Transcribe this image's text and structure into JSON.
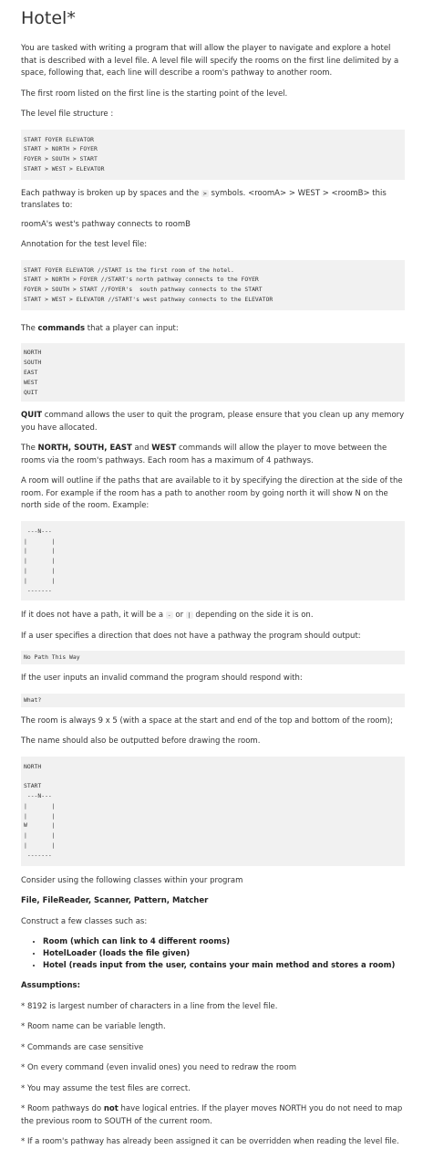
{
  "title": "Hotel*",
  "intro": "You are tasked with writing a program that will allow the player to navigate and explore a hotel that is described with a level file. A level file will specify the rooms on the first line delimited by a space, following that, each line will describe a room's pathway to another room.",
  "first_room": "The first room listed on the first line is the starting point of the level.",
  "structure_label": "The level file structure :",
  "structure_code": "START FOYER ELEVATOR\nSTART > NORTH > FOYER\nFOYER > SOUTH > START\nSTART > WEST > ELEVATOR",
  "pathway_pre": "Each pathway is broken up by spaces and the ",
  "pathway_symbol": ">",
  "pathway_post": " symbols. <roomA> > WEST  > <roomB> this translates to:",
  "pathway_result": "roomA's west's pathway connects to roomB",
  "annotation_label": "Annotation for the test level file:",
  "annotation_code": "START FOYER ELEVATOR //START is the first room of the hotel.\nSTART > NORTH > FOYER //START's north pathway connects to the FOYER\nFOYER > SOUTH > START //FOYER's  south pathway connects to the START\nSTART > WEST > ELEVATOR //START's west pathway connects to the ELEVATOR",
  "commands_pre": "The ",
  "commands_bold": "commands",
  "commands_post": " that a player can input:",
  "commands_code": "NORTH\nSOUTH\nEAST\nWEST\nQUIT",
  "quit_bold": "QUIT",
  "quit_text": " command allows the user to quit the program, please ensure that you clean up any memory you have allocated.",
  "dirs_pre": "The ",
  "dirs_bold1": "NORTH, SOUTH, EAST",
  "dirs_and": " and ",
  "dirs_bold2": "WEST",
  "dirs_post": " commands will allow the player to move between the rooms via the room's pathways. Each room has a maximum of 4 pathways.",
  "outline_text": "A room will outline if the paths that are available to it by specifying the direction at the side of the room. For example if the room has a path to another room by going north it will show N on the north side of the room. Example:",
  "room_example_code": " ---N---\n|       |\n|       |\n|       |\n|       |\n|       |\n -------",
  "nopath_pre": "If it does not have a path, it will be a ",
  "nopath_dash": "-",
  "nopath_or": " or ",
  "nopath_pipe": "|",
  "nopath_post": " depending on the side it is on.",
  "nopath_output_label": "If a user specifies a direction that does not have a pathway the program should output:",
  "nopath_output_code": "No Path This Way",
  "invalid_label": "If the user inputs an invalid command the program should respond with:",
  "invalid_code": "What?",
  "room_size": "The room is always 9 x 5 (with a space at the start and end of the top and bottom of the room);",
  "room_name": "The name should also be outputted before drawing the room.",
  "draw_example_code": "NORTH\n\nSTART\n ---N---\n|       |\n|       |\nW       |\n|       |\n|       |\n -------",
  "classes_label": "Consider using the following classes within your program",
  "classes_bold": "File, FileReader, Scanner, Pattern, Matcher",
  "construct_label": "Construct a few classes such as:",
  "construct_items": [
    "Room (which can link to 4 different rooms)",
    "HotelLoader (loads the file given)",
    "Hotel (reads input from the user, contains your main method and stores a room)"
  ],
  "assumptions_label": "Assumptions:",
  "assume1": "* 8192 is largest number of characters in a line from the level file.",
  "assume2": "* Room name can be variable length.",
  "assume3": "* Commands are case sensitive",
  "assume4": "* On every command (even invalid ones) you need to redraw the room",
  "assume5": "* You may assume the test files are correct.",
  "assume6_pre": "* Room pathways do ",
  "assume6_bold": "not",
  "assume6_post": " have logical entries. If the player moves NORTH you do not need to map the previous room to SOUTH of the current room.",
  "assume7": "* If a room's pathway has already been assigned it can be overridden when reading the level file."
}
